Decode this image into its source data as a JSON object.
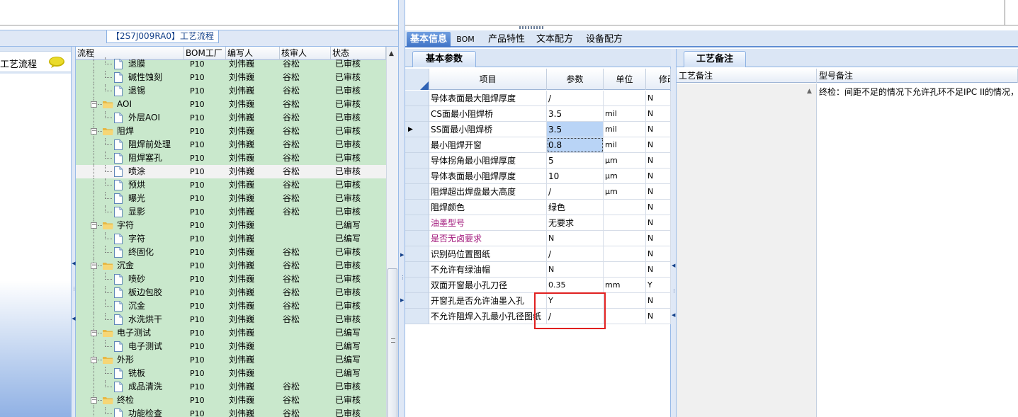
{
  "left": {
    "panel_title": "【2S7J009RA0】工艺流程",
    "nav_item_label": "工艺流程",
    "columns": [
      "流程",
      "BOM工厂",
      "编写人",
      "核审人",
      "状态"
    ],
    "rows": [
      {
        "level": 2,
        "type": "doc",
        "name": "退膜",
        "plant": "P10",
        "author": "刘伟巍",
        "reviewer": "谷松",
        "status": "已审核",
        "partial": true
      },
      {
        "level": 2,
        "type": "doc",
        "name": "碱性蚀刻",
        "plant": "P10",
        "author": "刘伟巍",
        "reviewer": "谷松",
        "status": "已审核"
      },
      {
        "level": 2,
        "type": "doc",
        "name": "退锡",
        "plant": "P10",
        "author": "刘伟巍",
        "reviewer": "谷松",
        "status": "已审核"
      },
      {
        "level": 1,
        "type": "folder",
        "name": "AOI",
        "plant": "P10",
        "author": "刘伟巍",
        "reviewer": "谷松",
        "status": "已审核"
      },
      {
        "level": 2,
        "type": "doc",
        "name": "外层AOI",
        "plant": "P10",
        "author": "刘伟巍",
        "reviewer": "谷松",
        "status": "已审核"
      },
      {
        "level": 1,
        "type": "folder",
        "name": "阻焊",
        "plant": "P10",
        "author": "刘伟巍",
        "reviewer": "谷松",
        "status": "已审核"
      },
      {
        "level": 2,
        "type": "doc",
        "name": "阻焊前处理",
        "plant": "P10",
        "author": "刘伟巍",
        "reviewer": "谷松",
        "status": "已审核"
      },
      {
        "level": 2,
        "type": "doc",
        "name": "阻焊塞孔",
        "plant": "P10",
        "author": "刘伟巍",
        "reviewer": "谷松",
        "status": "已审核"
      },
      {
        "level": 2,
        "type": "doc",
        "name": "喷涂",
        "plant": "P10",
        "author": "刘伟巍",
        "reviewer": "谷松",
        "status": "已审核",
        "selected": true
      },
      {
        "level": 2,
        "type": "doc",
        "name": "预烘",
        "plant": "P10",
        "author": "刘伟巍",
        "reviewer": "谷松",
        "status": "已审核"
      },
      {
        "level": 2,
        "type": "doc",
        "name": "曝光",
        "plant": "P10",
        "author": "刘伟巍",
        "reviewer": "谷松",
        "status": "已审核"
      },
      {
        "level": 2,
        "type": "doc",
        "name": "显影",
        "plant": "P10",
        "author": "刘伟巍",
        "reviewer": "谷松",
        "status": "已审核"
      },
      {
        "level": 1,
        "type": "folder",
        "name": "字符",
        "plant": "P10",
        "author": "刘伟巍",
        "reviewer": "",
        "status": "已编写"
      },
      {
        "level": 2,
        "type": "doc",
        "name": "字符",
        "plant": "P10",
        "author": "刘伟巍",
        "reviewer": "",
        "status": "已编写"
      },
      {
        "level": 2,
        "type": "doc",
        "name": "终固化",
        "plant": "P10",
        "author": "刘伟巍",
        "reviewer": "谷松",
        "status": "已审核"
      },
      {
        "level": 1,
        "type": "folder",
        "name": "沉金",
        "plant": "P10",
        "author": "刘伟巍",
        "reviewer": "谷松",
        "status": "已审核"
      },
      {
        "level": 2,
        "type": "doc",
        "name": "喷砂",
        "plant": "P10",
        "author": "刘伟巍",
        "reviewer": "谷松",
        "status": "已审核"
      },
      {
        "level": 2,
        "type": "doc",
        "name": "板边包胶",
        "plant": "P10",
        "author": "刘伟巍",
        "reviewer": "谷松",
        "status": "已审核"
      },
      {
        "level": 2,
        "type": "doc",
        "name": "沉金",
        "plant": "P10",
        "author": "刘伟巍",
        "reviewer": "谷松",
        "status": "已审核"
      },
      {
        "level": 2,
        "type": "doc",
        "name": "水洗烘干",
        "plant": "P10",
        "author": "刘伟巍",
        "reviewer": "谷松",
        "status": "已审核"
      },
      {
        "level": 1,
        "type": "folder",
        "name": "电子测试",
        "plant": "P10",
        "author": "刘伟巍",
        "reviewer": "",
        "status": "已编写"
      },
      {
        "level": 2,
        "type": "doc",
        "name": "电子测试",
        "plant": "P10",
        "author": "刘伟巍",
        "reviewer": "",
        "status": "已编写"
      },
      {
        "level": 1,
        "type": "folder",
        "name": "外形",
        "plant": "P10",
        "author": "刘伟巍",
        "reviewer": "",
        "status": "已编写"
      },
      {
        "level": 2,
        "type": "doc",
        "name": "铣板",
        "plant": "P10",
        "author": "刘伟巍",
        "reviewer": "",
        "status": "已编写"
      },
      {
        "level": 2,
        "type": "doc",
        "name": "成品清洗",
        "plant": "P10",
        "author": "刘伟巍",
        "reviewer": "谷松",
        "status": "已审核"
      },
      {
        "level": 1,
        "type": "folder",
        "name": "终检",
        "plant": "P10",
        "author": "刘伟巍",
        "reviewer": "谷松",
        "status": "已审核"
      },
      {
        "level": 2,
        "type": "doc",
        "name": "功能检查",
        "plant": "P10",
        "author": "刘伟巍",
        "reviewer": "谷松",
        "status": "已审核"
      }
    ]
  },
  "tabs": [
    "基本信息",
    "BOM",
    "产品特性",
    "文本配方",
    "设备配方"
  ],
  "basic_params": {
    "subtab": "基本参数",
    "columns": [
      "项目",
      "参数",
      "单位",
      "修改"
    ],
    "rows": [
      {
        "item": "导体表面最大阻焊厚度",
        "param": "/",
        "unit": "",
        "mod": "N"
      },
      {
        "item": "CS面最小阻焊桥",
        "param": "3.5",
        "unit": "mil",
        "mod": "N"
      },
      {
        "item": "SS面最小阻焊桥",
        "param": "3.5",
        "unit": "mil",
        "mod": "N",
        "current": true
      },
      {
        "item": "最小阻焊开窗",
        "param": "0.8",
        "unit": "mil",
        "mod": "N",
        "cursor": true
      },
      {
        "item": "导体拐角最小阻焊厚度",
        "param": "5",
        "unit": "μm",
        "mod": "N"
      },
      {
        "item": "导体表面最小阻焊厚度",
        "param": "10",
        "unit": "μm",
        "mod": "N"
      },
      {
        "item": "阻焊超出焊盘最大高度",
        "param": "/",
        "unit": "μm",
        "mod": "N"
      },
      {
        "item": "阻焊颜色",
        "param": "绿色",
        "unit": "",
        "mod": "N"
      },
      {
        "item": "油墨型号",
        "param": "无要求",
        "unit": "",
        "mod": "N",
        "color": "#a0147a"
      },
      {
        "item": "是否无卤要求",
        "param": "N",
        "unit": "",
        "mod": "N",
        "color": "#a0147a"
      },
      {
        "item": "识别码位置图纸",
        "param": "/",
        "unit": "",
        "mod": "N"
      },
      {
        "item": "不允许有绿油帽",
        "param": "N",
        "unit": "",
        "mod": "N"
      },
      {
        "item": "双面开窗最小孔刀径",
        "param": "0.35",
        "unit": "mm",
        "mod": "Y"
      },
      {
        "item": "开窗孔是否允许油墨入孔",
        "param": "Y",
        "unit": "",
        "mod": "N"
      },
      {
        "item": "不允许阻焊入孔最小孔径图纸",
        "param": "/",
        "unit": "",
        "mod": "N"
      }
    ]
  },
  "process_notes": {
    "subtab": "工艺备注",
    "columns": [
      "工艺备注",
      "型号备注"
    ],
    "model_note": "终检：间距不足的情况下允许孔环不足IPC II的情况，"
  },
  "colors": {
    "grid_green": "#c9e8cc",
    "tab_active": "#3f73c6",
    "highlight_box": "#e02020",
    "magenta_text": "#a0147a"
  }
}
